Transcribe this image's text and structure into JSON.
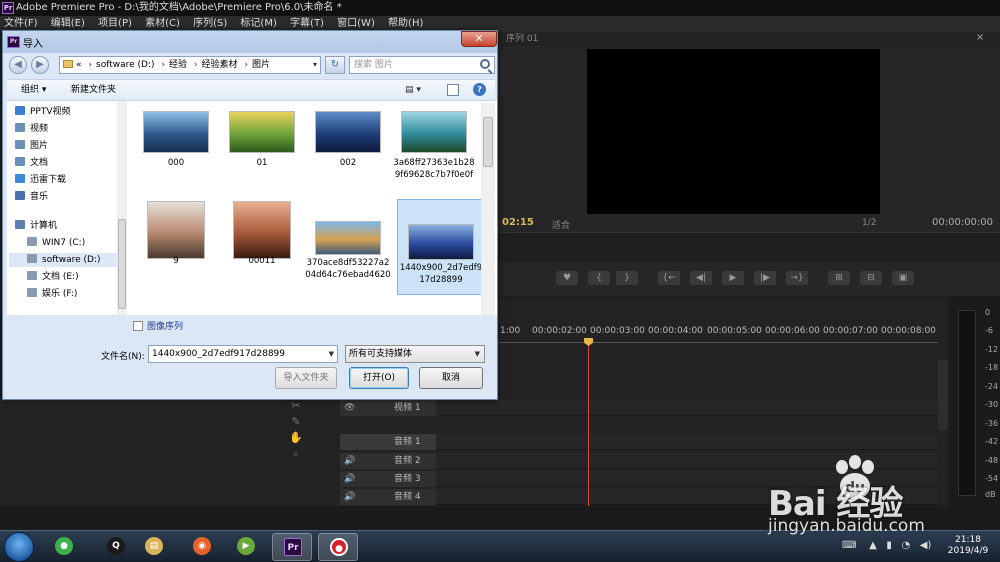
{
  "app": {
    "title": "Adobe Premiere Pro - D:\\我的文档\\Adobe\\Premiere Pro\\6.0\\未命名 *",
    "menu": [
      "文件(F)",
      "编辑(E)",
      "项目(P)",
      "素材(C)",
      "序列(S)",
      "标记(M)",
      "字幕(T)",
      "窗口(W)",
      "帮助(H)"
    ]
  },
  "monitor": {
    "tab": "序列 01",
    "close": "×",
    "timecode_left": "02:15",
    "fit": "适合",
    "resolution": "1/2",
    "timecode_right": "00:00:00:00",
    "transport": [
      "♥",
      "{",
      "}",
      "{←",
      "◀|",
      "▶",
      "|▶",
      "→}",
      "⊞",
      "⊟",
      "▣"
    ]
  },
  "timeline": {
    "ruler": [
      "1:00",
      "00:00:02:00",
      "00:00:03:00",
      "00:00:04:00",
      "00:00:05:00",
      "00:00:06:00",
      "00:00:07:00",
      "00:00:08:00"
    ],
    "tracks": [
      {
        "icon": "👁",
        "name": "视频 1"
      },
      {
        "icon": "",
        "name": "音频 1"
      },
      {
        "icon": "🔊",
        "name": "音频 2"
      },
      {
        "icon": "🔊",
        "name": "音频 3"
      },
      {
        "icon": "🔊",
        "name": "音频 4"
      }
    ],
    "meter_labels": [
      "0",
      "-6",
      "-12",
      "-18",
      "-24",
      "-30",
      "-36",
      "-42",
      "-48",
      "-54",
      "dB"
    ]
  },
  "dialog": {
    "title": "导入",
    "close": "✕",
    "address": {
      "prefix": "«",
      "parts": [
        "software (D:)",
        "经验",
        "经验素材",
        "图片"
      ]
    },
    "search_placeholder": "搜索 图片",
    "toolbar": {
      "organize": "组织 ▾",
      "new_folder": "新建文件夹"
    },
    "nav_items": [
      {
        "label": "PPTV视频",
        "color": "#3a7fd0"
      },
      {
        "label": "视频",
        "color": "#6a8fb8"
      },
      {
        "label": "图片",
        "color": "#6a8fb8"
      },
      {
        "label": "文档",
        "color": "#6a8fb8"
      },
      {
        "label": "迅雷下载",
        "color": "#3c8ad8"
      },
      {
        "label": "音乐",
        "color": "#4a6fa8"
      },
      {
        "label": "计算机",
        "color": "#5a7faa"
      },
      {
        "label": "WIN7 (C:)",
        "color": "#8a9ab0"
      },
      {
        "label": "software (D:)",
        "color": "#8a9ab0"
      },
      {
        "label": "文档 (E:)",
        "color": "#8a9ab0"
      },
      {
        "label": "娱乐 (F:)",
        "color": "#8a9ab0"
      }
    ],
    "files": [
      {
        "name": "000",
        "colors": [
          "#8fbfe8",
          "#2d5a8c",
          "#1a2f4d"
        ]
      },
      {
        "name": "01",
        "colors": [
          "#e8d35a",
          "#6fa33a",
          "#2e5a1c"
        ]
      },
      {
        "name": "002",
        "colors": [
          "#5d8cc8",
          "#1f3f7a",
          "#0c1a3a"
        ]
      },
      {
        "name": "3a68ff27363e1b289f69628c7b7f0e0f",
        "colors": [
          "#9fd4e0",
          "#2f8a9a",
          "#1d4a2a"
        ]
      },
      {
        "name": "9",
        "colors": [
          "#e8e0d8",
          "#b88a70",
          "#4a3a30"
        ]
      },
      {
        "name": "00011",
        "colors": [
          "#e8b090",
          "#a85a3a",
          "#3a1a10"
        ]
      },
      {
        "name": "370ace8df53227a204d64c76ebad4620",
        "colors": [
          "#7ab8e8",
          "#d8a050",
          "#3a5a7a"
        ]
      },
      {
        "name": "1440x900_2d7edf917d28899",
        "colors": [
          "#8ab0e0",
          "#2a4aa0",
          "#101a40"
        ]
      }
    ],
    "image_sequence": "图像序列",
    "filename_label": "文件名(N):",
    "filename_value": "1440x900_2d7edf917d28899",
    "filetype_value": "所有可支持媒体",
    "buttons": {
      "import_folder": "导入文件夹",
      "open": "打开(O)",
      "cancel": "取消"
    }
  },
  "taskbar": {
    "apps": [
      {
        "glyph": "●",
        "color": "#3cb04a"
      },
      {
        "glyph": "Q",
        "color": "#1a1a1a"
      },
      {
        "glyph": "▤",
        "color": "#d8b45a"
      },
      {
        "glyph": "◉",
        "color": "#e8632a"
      },
      {
        "glyph": "▶",
        "color": "#6aa83a"
      },
      {
        "glyph": "Pr",
        "color": "#2a0a3f"
      },
      {
        "glyph": "●",
        "color": "#d8202a"
      }
    ],
    "time": "21:18",
    "date": "2019/4/9"
  },
  "watermark": {
    "brand": "Bai 经验",
    "url": "jingyan.baidu.com"
  }
}
